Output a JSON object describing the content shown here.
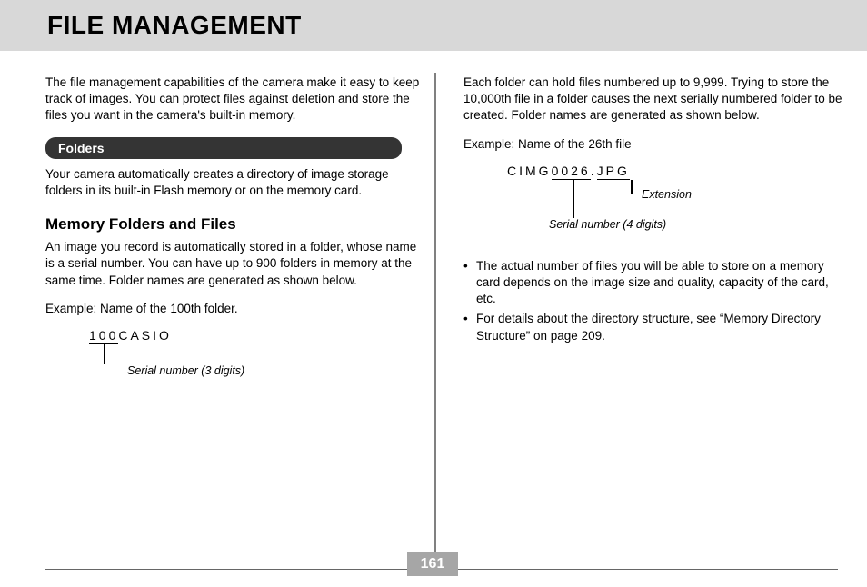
{
  "header": {
    "title": "FILE MANAGEMENT"
  },
  "left": {
    "intro": "The file management capabilities of the camera make it easy to keep track of images. You can protect files against deletion and store the files you want in the camera's built-in memory.",
    "folders_heading": "Folders",
    "folders_para": "Your camera automatically creates a directory of image storage folders in its built-in Flash memory or on the memory card.",
    "mff_heading": "Memory Folders and Files",
    "mff_para": "An image you record is automatically stored in a folder, whose name is a serial number. You can have up to 900 folders in memory at the same time. Folder names are generated as shown below.",
    "example_label": "Example: Name of the 100th folder.",
    "folder_example": {
      "serial": "100",
      "rest": "CASIO",
      "caption": "Serial number (3 digits)"
    }
  },
  "right": {
    "intro": "Each folder can hold files numbered up to 9,999. Trying to store the 10,000th file in a folder causes the next serially numbered folder to be created. Folder names are generated as shown below.",
    "example_label": "Example: Name of the 26th file",
    "file_example": {
      "prefix": "CIMG",
      "serial": "0026",
      "dot": ".",
      "ext": "JPG",
      "caption_ext": "Extension",
      "caption_sn": "Serial number (4 digits)"
    },
    "bullets": [
      "The actual number of files you will be able to store on a memory card depends on the image size and quality, capacity of the card, etc.",
      "For details about the directory structure, see “Memory Directory Structure” on page 209."
    ]
  },
  "page_number": "161"
}
